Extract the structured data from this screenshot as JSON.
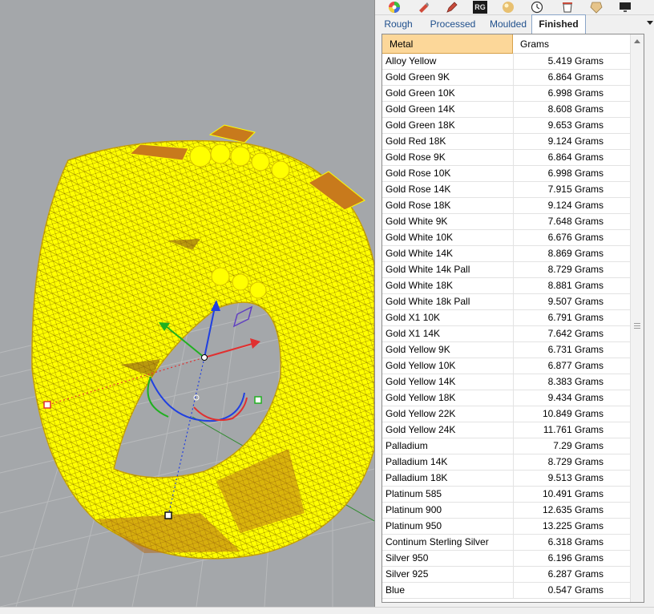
{
  "colors": {
    "accent_header": "#fcd799",
    "tab_text": "#1f4f8c",
    "model_fill": "#ffff00",
    "viewport_bg": "#a4a7aa"
  },
  "toolbar": {
    "icons": [
      "color-wheel-icon",
      "render-cube-icon",
      "pen-tool-icon",
      "rg-plugin-icon",
      "material-sphere-icon",
      "dial-clock-icon",
      "cup-icon",
      "gem-icon",
      "display-icon"
    ],
    "rg_label": "RG"
  },
  "tabs": [
    {
      "label": "Rough",
      "active": false
    },
    {
      "label": "Processed",
      "active": false
    },
    {
      "label": "Moulded",
      "active": false
    },
    {
      "label": "Finished",
      "active": true
    }
  ],
  "table": {
    "headers": {
      "metal": "Metal",
      "grams": "Grams"
    },
    "rows": [
      {
        "metal": "Alloy Yellow",
        "grams": "5.419 Grams"
      },
      {
        "metal": "Gold Green 9K",
        "grams": "6.864 Grams"
      },
      {
        "metal": "Gold Green 10K",
        "grams": "6.998 Grams"
      },
      {
        "metal": "Gold Green 14K",
        "grams": "8.608 Grams"
      },
      {
        "metal": "Gold Green 18K",
        "grams": "9.653 Grams"
      },
      {
        "metal": "Gold Red 18K",
        "grams": "9.124 Grams"
      },
      {
        "metal": "Gold Rose 9K",
        "grams": "6.864 Grams"
      },
      {
        "metal": "Gold Rose 10K",
        "grams": "6.998 Grams"
      },
      {
        "metal": "Gold Rose 14K",
        "grams": "7.915 Grams"
      },
      {
        "metal": "Gold Rose 18K",
        "grams": "9.124 Grams"
      },
      {
        "metal": "Gold White 9K",
        "grams": "7.648 Grams"
      },
      {
        "metal": "Gold White 10K",
        "grams": "6.676 Grams"
      },
      {
        "metal": "Gold White 14K",
        "grams": "8.869 Grams"
      },
      {
        "metal": "Gold White 14k Pall",
        "grams": "8.729 Grams"
      },
      {
        "metal": "Gold White 18K",
        "grams": "8.881 Grams"
      },
      {
        "metal": "Gold White 18k Pall",
        "grams": "9.507 Grams"
      },
      {
        "metal": "Gold X1 10K",
        "grams": "6.791 Grams"
      },
      {
        "metal": "Gold X1 14K",
        "grams": "7.642 Grams"
      },
      {
        "metal": "Gold Yellow 9K",
        "grams": "6.731 Grams"
      },
      {
        "metal": "Gold Yellow 10K",
        "grams": "6.877 Grams"
      },
      {
        "metal": "Gold Yellow 14K",
        "grams": "8.383 Grams"
      },
      {
        "metal": "Gold Yellow 18K",
        "grams": "9.434 Grams"
      },
      {
        "metal": "Gold Yellow 22K",
        "grams": "10.849 Grams"
      },
      {
        "metal": "Gold Yellow 24K",
        "grams": "11.761 Grams"
      },
      {
        "metal": "Palladium",
        "grams": "7.29 Grams"
      },
      {
        "metal": "Palladium 14K",
        "grams": "8.729 Grams"
      },
      {
        "metal": "Palladium 18K",
        "grams": "9.513 Grams"
      },
      {
        "metal": "Platinum 585",
        "grams": "10.491 Grams"
      },
      {
        "metal": "Platinum 900",
        "grams": "12.635 Grams"
      },
      {
        "metal": "Platinum 950",
        "grams": "13.225 Grams"
      },
      {
        "metal": "Continum Sterling Silver",
        "grams": "6.318 Grams"
      },
      {
        "metal": "Silver 950",
        "grams": "6.196 Grams"
      },
      {
        "metal": "Silver 925",
        "grams": "6.287 Grams"
      },
      {
        "metal": "Blue",
        "grams": "0.547 Grams"
      }
    ]
  }
}
